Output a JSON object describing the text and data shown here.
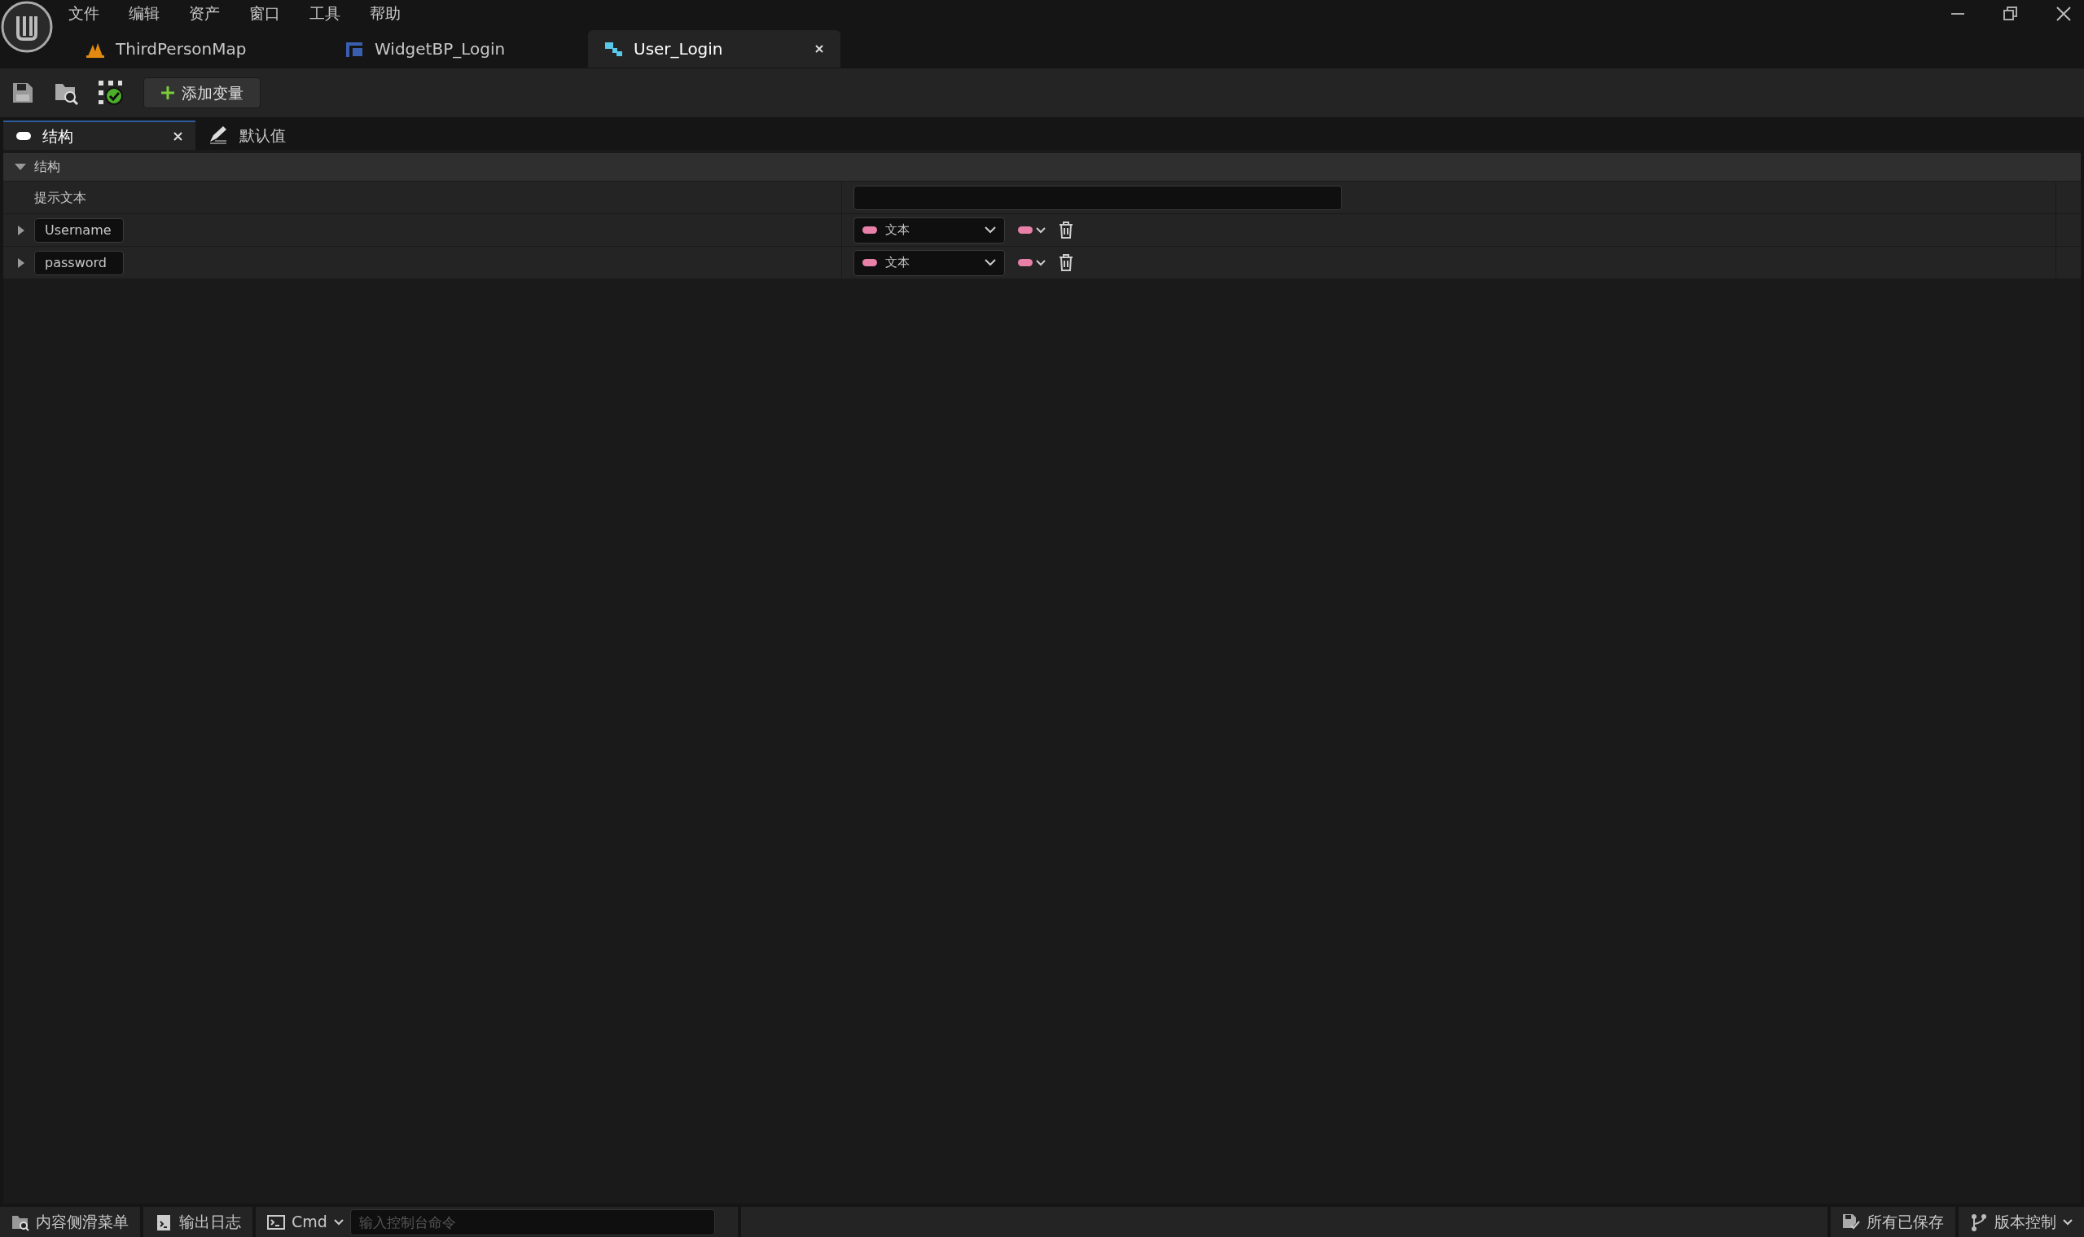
{
  "menu": [
    "文件",
    "编辑",
    "资产",
    "窗口",
    "工具",
    "帮助"
  ],
  "document_tabs": [
    {
      "label": "ThirdPersonMap",
      "kind": "level",
      "selected": false
    },
    {
      "label": "WidgetBP_Login",
      "kind": "widget",
      "selected": false
    },
    {
      "label": "User_Login",
      "kind": "struct",
      "selected": true
    }
  ],
  "toolbar": {
    "add_button": "添加变量"
  },
  "panel_tabs": [
    {
      "label": "结构",
      "kind": "struct",
      "selected": true
    },
    {
      "label": "默认值",
      "kind": "defaults",
      "selected": false
    }
  ],
  "section": {
    "title": "结构",
    "expanded": true
  },
  "tooltip_row": {
    "label": "提示文本"
  },
  "members": [
    {
      "name": "Username",
      "type": "文本",
      "expanded": false
    },
    {
      "name": "password",
      "type": "文本",
      "expanded": false
    }
  ],
  "status_bar": {
    "content_drawer": "内容侧滑菜单",
    "output_log": "输出日志",
    "cmd": "Cmd",
    "console_placeholder": "输入控制台命令",
    "save_state": "所有已保存",
    "source_control": "版本控制"
  }
}
